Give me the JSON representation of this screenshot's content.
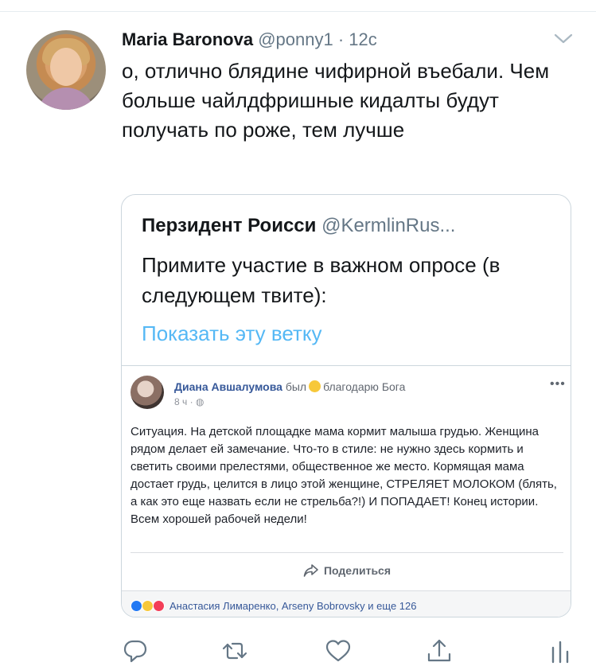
{
  "tweet": {
    "author_name": "Maria Baronova",
    "author_handle": "@ponny1",
    "separator": "·",
    "time": "12с",
    "text": "о, отлично блядине чифирной въебали. Чем больше чайлдфришные кидалты будут получать по роже, тем лучше"
  },
  "quote": {
    "author_name": "Перзидент Роисси",
    "author_handle": "@KermlinRus...",
    "text": "Примите участие в важном опросе (в следующем твите):",
    "thread_link": "Показать эту ветку"
  },
  "facebook_post": {
    "author_name": "Диана Авшалумова",
    "feeling_prefix": "был",
    "feeling_text": "благодарю Бога",
    "time": "8 ч ·",
    "more": "•••",
    "body": "Ситуация. На детской площадке мама кормит малыша грудью. Женщина рядом делает ей замечание. Что-то в стиле: не нужно здесь кормить и светить своими прелестями, общественное же место. Кормящая мама достает грудь, целится в лицо этой женщине, СТРЕЛЯЕТ МОЛОКОМ (блять, а как это еще назвать если не стрельба?!) И ПОПАДАЕТ! Конец истории. Всем хорошей рабочей недели!",
    "share_label": "Поделиться",
    "reactions_text": "Анастасия Лимаренко, Arseny Bobrovsky и еще 126"
  },
  "icons": {
    "reply": "reply-icon",
    "retweet": "retweet-icon",
    "like": "heart-icon",
    "share": "share-icon",
    "analytics": "analytics-icon",
    "caret": "chevron-down-icon"
  },
  "colors": {
    "text_primary": "#14171a",
    "text_secondary": "#657786",
    "link_blue": "#1da1f2",
    "border": "#ccd6dd",
    "fb_blue": "#365899"
  }
}
